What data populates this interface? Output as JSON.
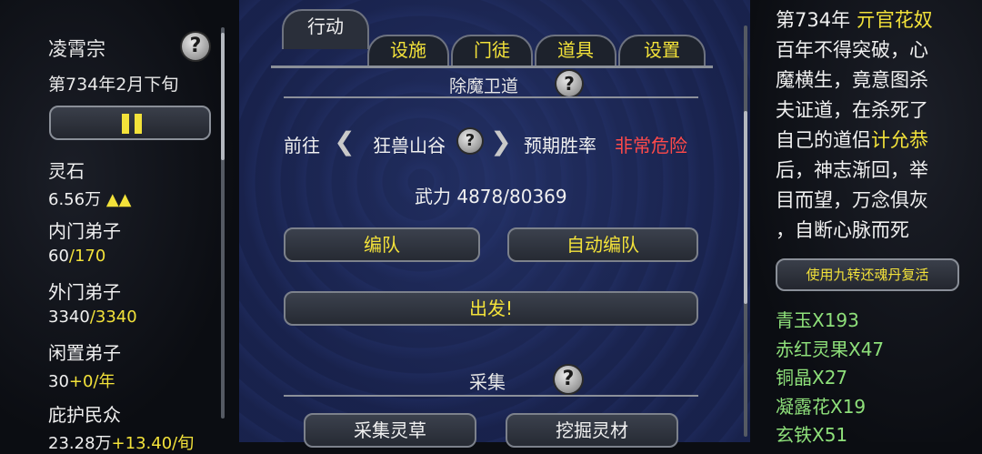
{
  "left": {
    "sect_name": "凌霄宗",
    "date": "第734年2月下旬",
    "stats": [
      {
        "label": "灵石",
        "value": "6.56万",
        "extra": "▲▲"
      },
      {
        "label": "内门弟子",
        "value": "60",
        "extra": "/170"
      },
      {
        "label": "外门弟子",
        "value": "3340",
        "extra": "/3340"
      },
      {
        "label": "闲置弟子",
        "value": "30",
        "extra": "+0/年"
      },
      {
        "label": "庇护民众",
        "value": "23.28万",
        "extra": "+13.40/旬"
      }
    ]
  },
  "tabs": [
    "行动",
    "设施",
    "门徒",
    "道具",
    "设置"
  ],
  "center": {
    "top_section": "除魔卫道",
    "goto_label": "前往",
    "location": "狂兽山谷",
    "win_rate_label": "预期胜率",
    "win_rate_value": "非常危险",
    "force": "武力 4878/80369",
    "btn_formation": "编队",
    "btn_auto_formation": "自动编队",
    "btn_depart": "出发!",
    "gather_section": "采集",
    "btn_gather_herbs": "采集灵草",
    "btn_dig_material": "挖掘灵材"
  },
  "right": {
    "story_prefix": "第734年 ",
    "story_name": "亓官花奴",
    "story_lines": [
      "百年不得突破，心",
      "魔横生，竟意图杀",
      "夫证道，在杀死了"
    ],
    "story_line4_pre": "自己的道侣",
    "story_line4_name": "计允恭",
    "story_lines_after": [
      "后，神志渐回，举",
      "目而望，万念俱灰",
      "，自断心脉而死"
    ],
    "revive_btn": "使用九转还魂丹复活",
    "inventory": [
      {
        "name": "青玉",
        "count": "X193"
      },
      {
        "name": "赤红灵果",
        "count": "X47"
      },
      {
        "name": "铜晶",
        "count": "X27"
      },
      {
        "name": "凝露花",
        "count": "X19"
      },
      {
        "name": "玄铁",
        "count": "X51"
      }
    ]
  },
  "colors": {
    "accent_yellow": "#f3e23a",
    "danger_red": "#ff4a4a",
    "item_green": "#8ee07a",
    "panel_blue": "#19224d"
  }
}
